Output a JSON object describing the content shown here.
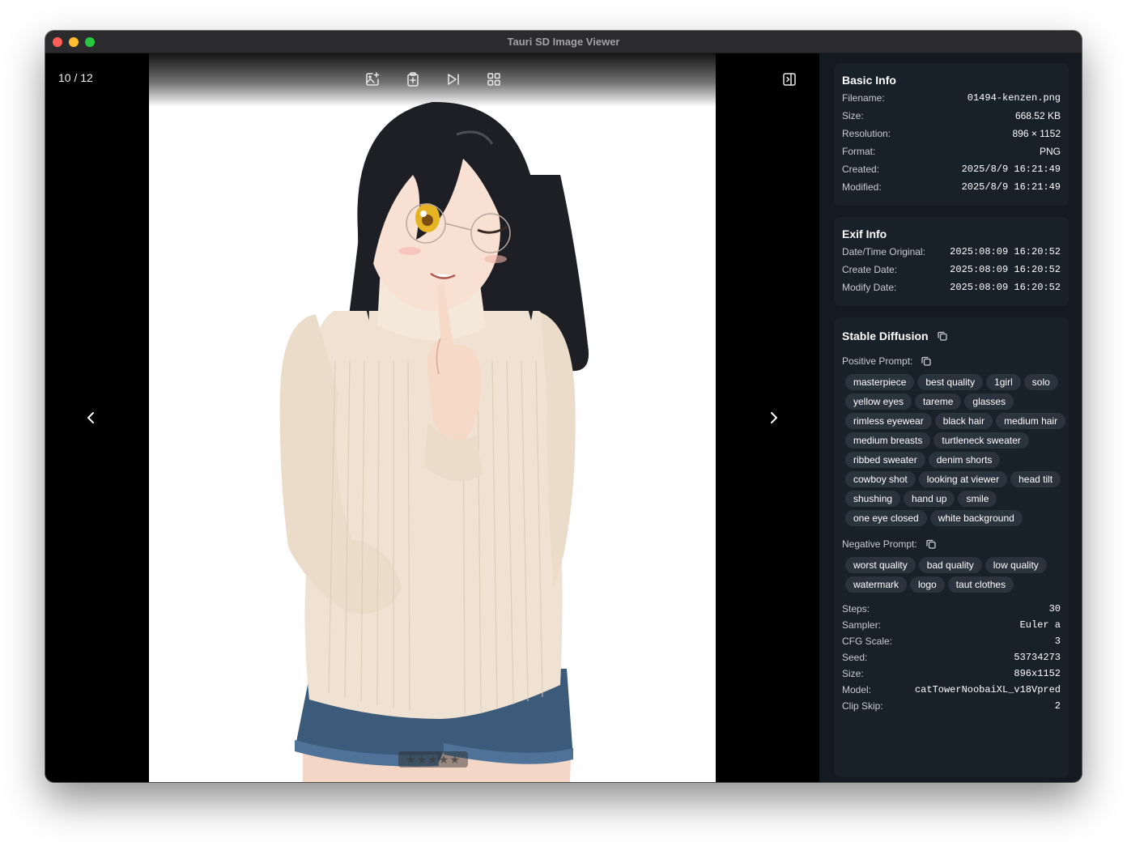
{
  "window": {
    "title": "Tauri SD Image Viewer"
  },
  "viewer": {
    "counter": "10 / 12",
    "toolbar": [
      {
        "name": "image-edit-icon"
      },
      {
        "name": "clipboard-icon"
      },
      {
        "name": "skip-forward-icon"
      },
      {
        "name": "grid-icon"
      }
    ],
    "rating": {
      "stars": "★★★★★",
      "value": 0,
      "max": 5
    }
  },
  "basic_info": {
    "title": "Basic Info",
    "rows": [
      {
        "label": "Filename:",
        "value": "01494-kenzen.png"
      },
      {
        "label": "Size:",
        "value": "668.52 KB"
      },
      {
        "label": "Resolution:",
        "value": "896 × 1152"
      },
      {
        "label": "Format:",
        "value": "PNG"
      },
      {
        "label": "Created:",
        "value": "2025/8/9 16:21:49"
      },
      {
        "label": "Modified:",
        "value": "2025/8/9 16:21:49"
      }
    ]
  },
  "exif_info": {
    "title": "Exif Info",
    "rows": [
      {
        "label": "Date/Time Original:",
        "value": "2025:08:09 16:20:52"
      },
      {
        "label": "Create Date:",
        "value": "2025:08:09 16:20:52"
      },
      {
        "label": "Modify Date:",
        "value": "2025:08:09 16:20:52"
      }
    ]
  },
  "stable_diffusion": {
    "title": "Stable Diffusion",
    "positive_label": "Positive Prompt:",
    "positive_tags": [
      "masterpiece",
      "best quality",
      "1girl",
      "solo",
      "yellow eyes",
      "tareme",
      "glasses",
      "rimless eyewear",
      "black hair",
      "medium hair",
      "medium breasts",
      "turtleneck sweater",
      "ribbed sweater",
      "denim shorts",
      "cowboy shot",
      "looking at viewer",
      "head tilt",
      "shushing",
      "hand up",
      "smile",
      "one eye closed",
      "white background"
    ],
    "negative_label": "Negative Prompt:",
    "negative_tags": [
      "worst quality",
      "bad quality",
      "low quality",
      "watermark",
      "logo",
      "taut clothes"
    ],
    "params": [
      {
        "label": "Steps:",
        "value": "30"
      },
      {
        "label": "Sampler:",
        "value": "Euler a"
      },
      {
        "label": "CFG Scale:",
        "value": "3"
      },
      {
        "label": "Seed:",
        "value": "53734273"
      },
      {
        "label": "Size:",
        "value": "896x1152"
      },
      {
        "label": "Model:",
        "value": "catTowerNoobaiXL_v18Vpred"
      },
      {
        "label": "Clip Skip:",
        "value": "2"
      }
    ]
  },
  "colors": {
    "sidebar_bg": "#141a21",
    "card_bg": "#18202a",
    "tag_bg": "#2b333e",
    "hair": "#1d1f24",
    "sweater": "#efe2d2",
    "shorts": "#3c5a7a",
    "eye": "#e6b325"
  }
}
